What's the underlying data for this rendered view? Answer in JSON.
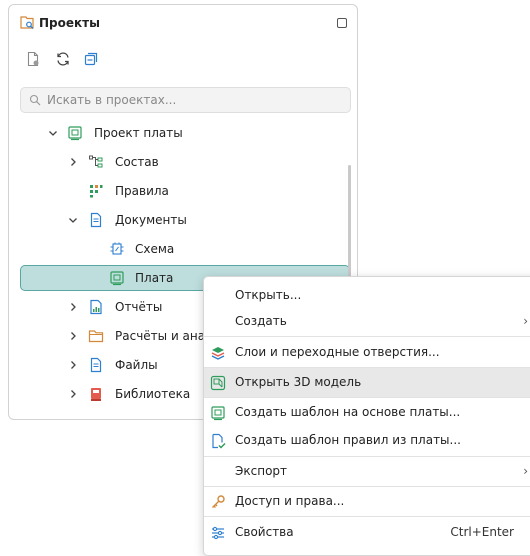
{
  "panel": {
    "title": "Проекты",
    "search_placeholder": "Искать в проектах..."
  },
  "tree": {
    "items": [
      {
        "label": "Проект платы",
        "icon": "board-project-icon",
        "expanded": true
      },
      {
        "label": "Состав",
        "icon": "composition-icon",
        "expanded": false
      },
      {
        "label": "Правила",
        "icon": "rules-icon"
      },
      {
        "label": "Документы",
        "icon": "document-icon",
        "expanded": true
      },
      {
        "label": "Схема",
        "icon": "schematic-icon"
      },
      {
        "label": "Плата",
        "icon": "board-icon",
        "selected": true
      },
      {
        "label": "Отчёты",
        "icon": "report-icon",
        "expanded": false
      },
      {
        "label": "Расчёты и анал",
        "icon": "folder-icon",
        "expanded": false
      },
      {
        "label": "Файлы",
        "icon": "file-icon",
        "expanded": false
      },
      {
        "label": "Библиотека",
        "icon": "library-icon",
        "expanded": false
      }
    ]
  },
  "menu": {
    "items": [
      {
        "label": "Открыть...",
        "icon": ""
      },
      {
        "label": "Создать",
        "icon": "",
        "submenu": "›"
      },
      {
        "label": "Слои и переходные отверстия...",
        "icon": "layers-icon"
      },
      {
        "label": "Открыть 3D модель",
        "icon": "3d-model-icon",
        "hovered": true
      },
      {
        "label": "Создать шаблон на основе платы...",
        "icon": "board-template-icon"
      },
      {
        "label": "Создать шаблон правил из платы...",
        "icon": "rules-template-icon"
      },
      {
        "label": "Экспорт",
        "icon": "",
        "submenu": "›"
      },
      {
        "label": "Доступ и права...",
        "icon": "key-icon"
      },
      {
        "label": "Свойства",
        "icon": "properties-icon",
        "shortcut": "Ctrl+Enter"
      }
    ]
  },
  "colors": {
    "selection_bg": "#bedede",
    "selection_border": "#58a7a3",
    "accent_green": "#2e9c5a",
    "accent_blue": "#2f7fd0"
  }
}
